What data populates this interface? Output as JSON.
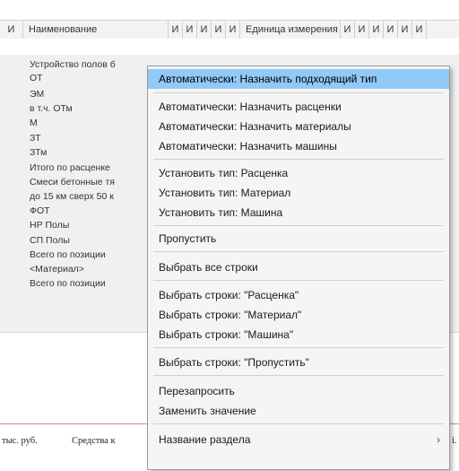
{
  "columns": [
    "И",
    "Наименование",
    "И",
    "И",
    "И",
    "И",
    "И",
    "Единица измерения",
    "И",
    "И",
    "И",
    "И",
    "И",
    "И"
  ],
  "rows": [
    "Устройство полов б",
    "ОТ",
    "ЭМ",
    "в т.ч. ОТм",
    "М",
    "ЗТ",
    "ЗТм",
    "Итого по расценке",
    "Смеси бетонные тя",
    "до 15 км сверх 50 к",
    "ФОТ",
    "НР Полы",
    "СП Полы",
    "Всего по позиции",
    "<Материал>",
    "Всего по позиции"
  ],
  "bottom_text_left": "тыс. руб.",
  "bottom_text_mid": "Средства к",
  "bottom_text_right": "i.",
  "menu": {
    "items": [
      {
        "label": "Автоматически: Назначить подходящий тип",
        "highlighted": true
      },
      {
        "label": "Автоматически: Назначить расценки"
      },
      {
        "label": "Автоматически: Назначить материалы"
      },
      {
        "label": "Автоматически: Назначить машины"
      },
      {
        "label": "Установить тип: Расценка"
      },
      {
        "label": "Установить тип: Материал"
      },
      {
        "label": "Установить тип: Машина"
      },
      {
        "label": "Пропустить"
      },
      {
        "label": "Выбрать все строки"
      },
      {
        "label": "Выбрать строки: \"Расценка\""
      },
      {
        "label": "Выбрать строки: \"Материал\""
      },
      {
        "label": "Выбрать строки: \"Машина\""
      },
      {
        "label": "Выбрать строки: \"Пропустить\""
      },
      {
        "label": "Перезапросить"
      },
      {
        "label": "Заменить значение"
      },
      {
        "label": "Название раздела",
        "submenu_arrow": "›"
      }
    ]
  },
  "colors": {
    "highlight": "#91c9f7",
    "data_bg": "#f0f0f0",
    "menu_bg": "#f5f5f5"
  }
}
